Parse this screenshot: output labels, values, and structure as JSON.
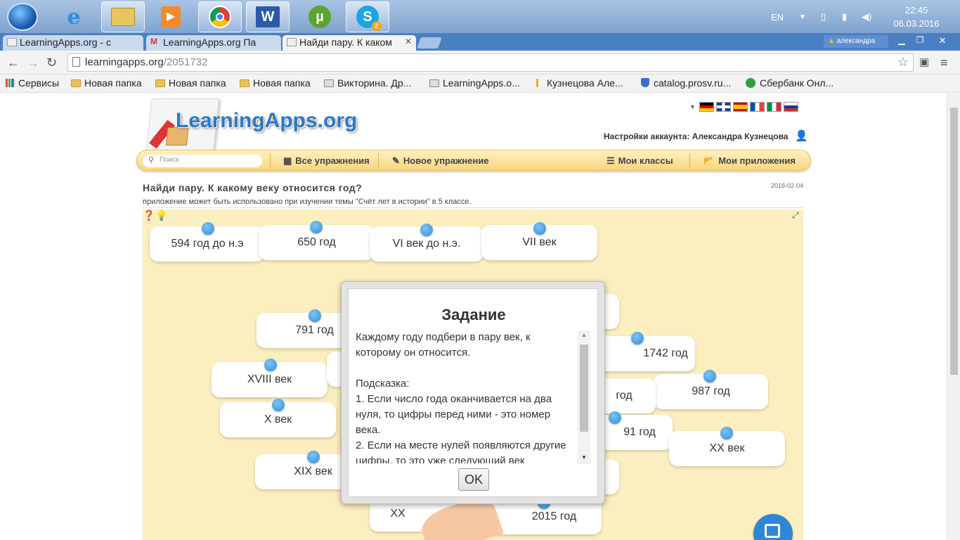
{
  "taskbar": {
    "apps": [
      "start",
      "internet-explorer",
      "file-explorer",
      "media-player",
      "chrome",
      "word",
      "utorrent",
      "skype"
    ],
    "skype_badge": "2",
    "lang": "EN",
    "time": "22:45",
    "date": "06.03.2016"
  },
  "browser": {
    "tabs": [
      {
        "label": "LearningApps.org - с"
      },
      {
        "label": "LearningApps.org Па"
      },
      {
        "label": "Найди пару. К каком"
      }
    ],
    "user_badge": "александра",
    "url_host": "learningapps.org",
    "url_path": "/2051732",
    "bookmarks": [
      {
        "label": "Сервисы",
        "icon": "apps-icon"
      },
      {
        "label": "Новая папка",
        "icon": "folder-icon"
      },
      {
        "label": "Новая папка",
        "icon": "folder-icon"
      },
      {
        "label": "Новая папка",
        "icon": "folder-icon"
      },
      {
        "label": "Викторина. Др...",
        "icon": "page-icon"
      },
      {
        "label": "LearningApps.o...",
        "icon": "page-icon"
      },
      {
        "label": "Кузнецова Але...",
        "icon": "page-icon"
      },
      {
        "label": "catalog.prosv.ru...",
        "icon": "shield-icon"
      },
      {
        "label": "Сбербанк Онл...",
        "icon": "sber-icon"
      }
    ]
  },
  "site": {
    "logo": "LearningApps.org",
    "account": "Настройки аккаунта: Александра Кузнецова",
    "search_placeholder": "Поиск",
    "menu": {
      "all": "Все упражнения",
      "new": "Новое упражнение",
      "classes": "Мои классы",
      "apps": "Мои приложения"
    }
  },
  "page": {
    "title": "Найди пару. К какому веку относится год?",
    "date": "2016-02-04",
    "subtitle": "приложение может быть использовано при изучении темы \"Счёт лет в истории\" в 5 классе."
  },
  "cards": {
    "c1": "594 год до н.э",
    "c2": "650 год",
    "c3": "VI век до н.э.",
    "c4": "VII век",
    "c5": "791 год",
    "c6": "XVIII век",
    "c7": "X век",
    "c8": "XIX век",
    "c9": "1742 год",
    "c10": "987 год",
    "c11": "год",
    "c12": "91 год",
    "c13": "XX век",
    "c14": "XX",
    "c15": "2015 год"
  },
  "dialog": {
    "title": "Задание",
    "text": "Каждому году подбери в пару век, к которому он относится.\n\nПодсказка:\n1. Если число года оканчивается на два нуля, то цифры перед ними - это номер века.\n2. Если на месте нулей появляются другие цифры, то это уже следующий век",
    "ok": "OK"
  }
}
